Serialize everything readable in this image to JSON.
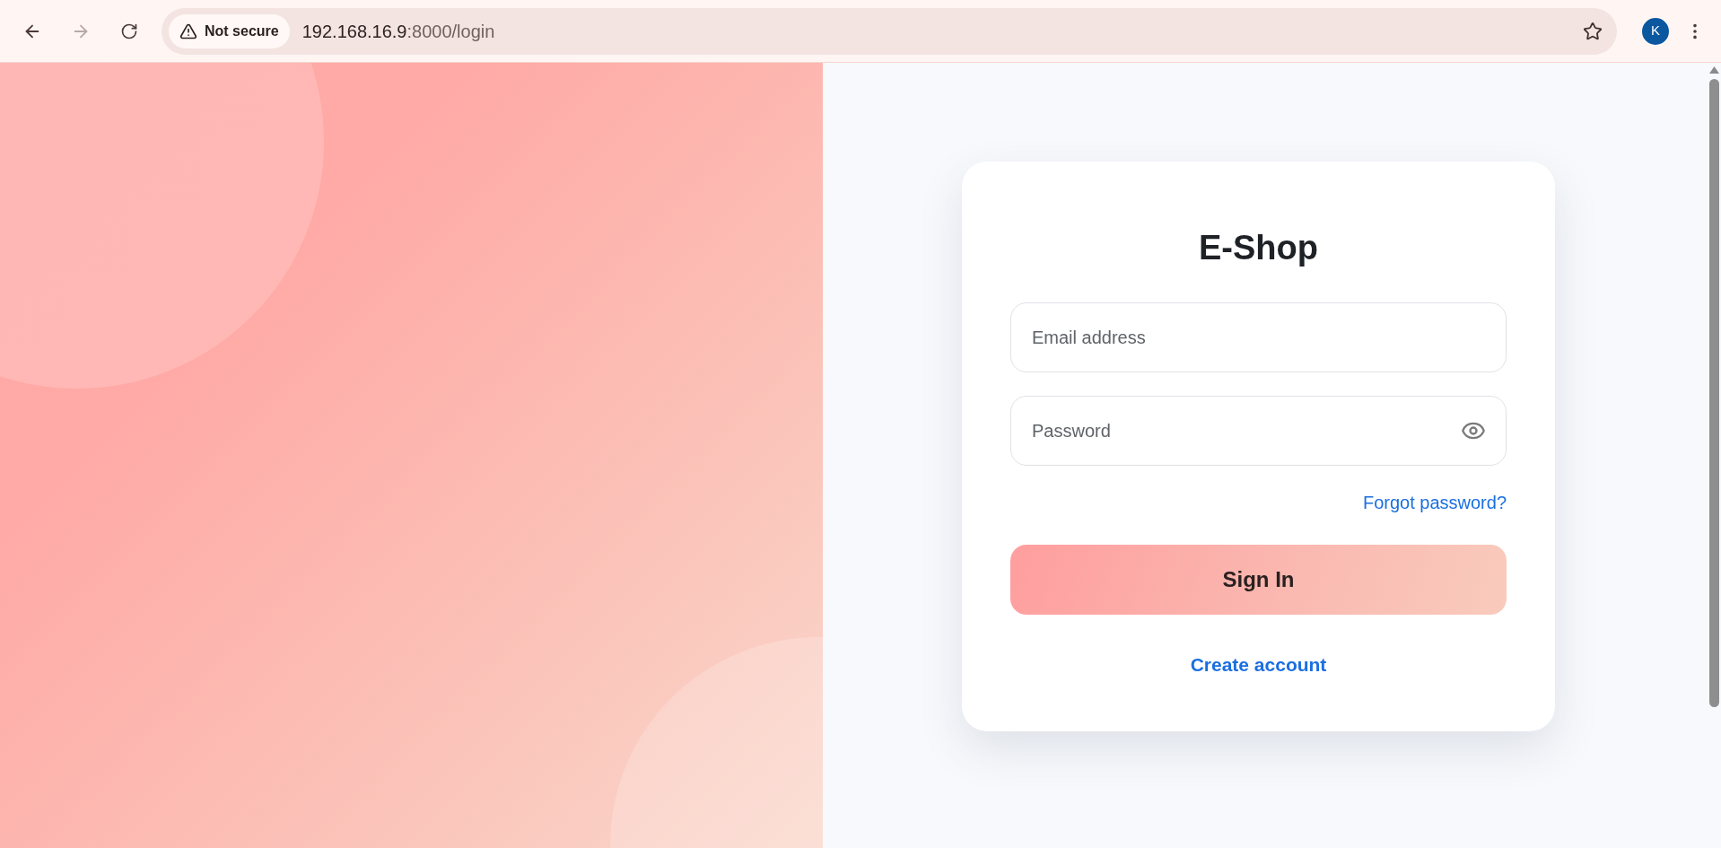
{
  "browser": {
    "back_disabled": false,
    "forward_disabled": true,
    "security_label": "Not secure",
    "url_host": "192.168.16.9",
    "url_path": ":8000/login",
    "avatar": "K"
  },
  "login": {
    "title": "E-Shop",
    "fields": [
      {
        "kind": "text",
        "placeholder": "Email address"
      },
      {
        "kind": "password",
        "placeholder": "Password"
      }
    ],
    "forgot_link": "Forgot password?",
    "submit": "Sign In",
    "create_link": "Create account"
  }
}
